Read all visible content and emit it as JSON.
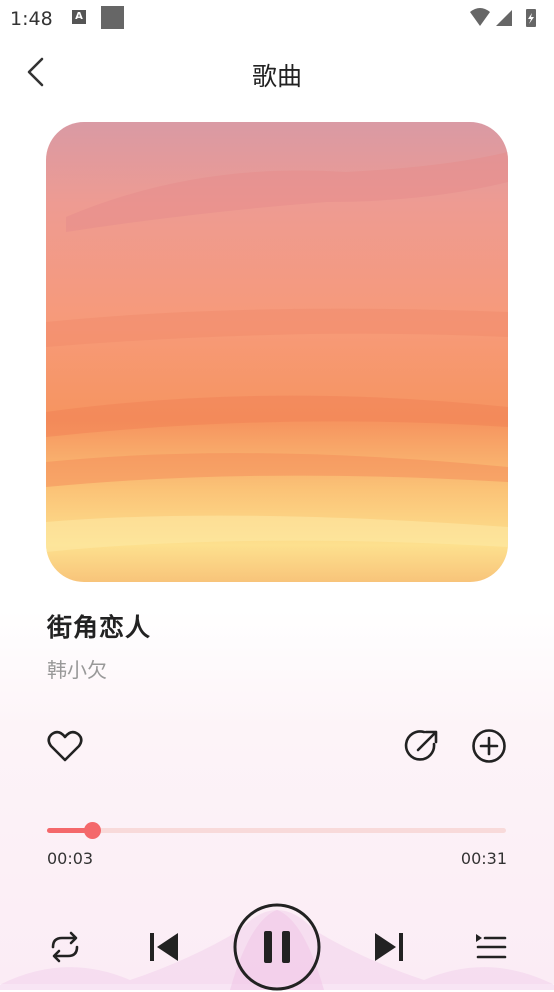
{
  "status": {
    "time": "1:48",
    "notification_letter": "A"
  },
  "header": {
    "title": "歌曲"
  },
  "song": {
    "title": "街角恋人",
    "artist": "韩小欠"
  },
  "progress": {
    "current": "00:03",
    "total": "00:31",
    "fraction": 0.097
  },
  "colors": {
    "accent": "#f4686b",
    "track": "#f8dada",
    "text": "#222222",
    "muted": "#999999"
  },
  "icons": {
    "back": "chevron-left-icon",
    "like": "heart-icon",
    "share": "share-icon",
    "add": "plus-circle-icon",
    "repeat": "repeat-icon",
    "prev": "skip-previous-icon",
    "pause": "pause-icon",
    "next": "skip-next-icon",
    "playlist": "playlist-icon"
  }
}
